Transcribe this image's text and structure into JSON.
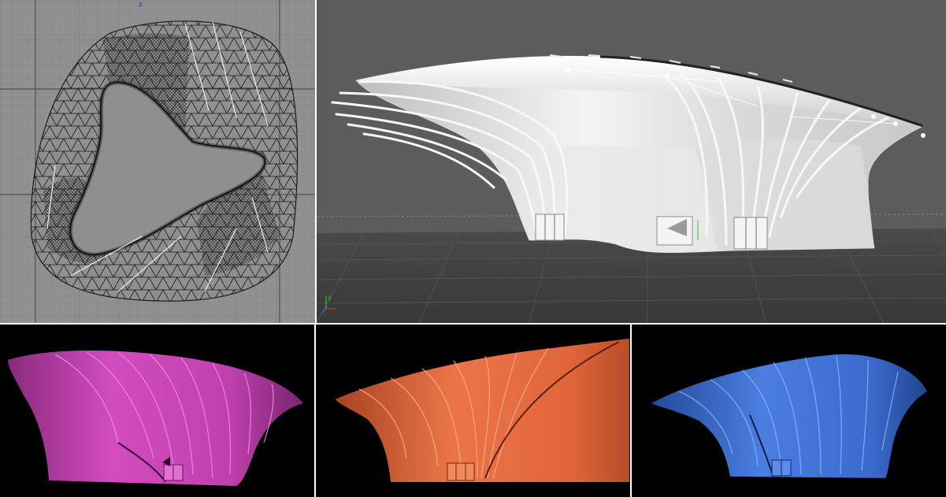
{
  "viewports": {
    "top": {
      "axis_label": "z"
    },
    "perspective": {
      "axis_label_y": "y"
    }
  },
  "renders": [
    {
      "color": "#c23fb1"
    },
    {
      "color": "#d9633a"
    },
    {
      "color": "#3a67c9"
    }
  ],
  "colors": {
    "viewport_top_bg": "#8f8f8f",
    "viewport_persp_bg": "#5c5c5c",
    "wire": "#1a1a1a",
    "structure": "#f2f2f2"
  }
}
